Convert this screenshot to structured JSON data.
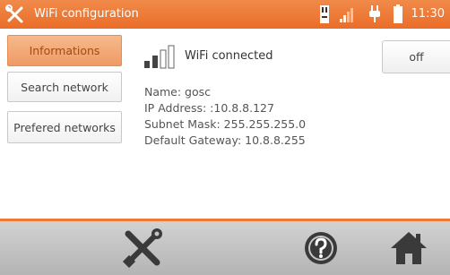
{
  "titlebar": {
    "title": "WiFi configuration",
    "time": "11:30",
    "icons": [
      "wrench-screwdriver-icon",
      "sd-card-icon",
      "signal-strength-icon",
      "plug-icon",
      "battery-icon"
    ]
  },
  "sidebar": {
    "items": [
      {
        "label": "Informations",
        "active": true
      },
      {
        "label": "Search network",
        "active": false
      },
      {
        "label": "Prefered networks",
        "active": false
      }
    ]
  },
  "wifi": {
    "status": "WiFi connected",
    "toggle_label": "off",
    "signal_bars_filled": 2,
    "signal_bars_total": 4
  },
  "info": {
    "name": "Name: gosc",
    "ip": "IP Address: :10.8.8.127",
    "mask": "Subnet Mask: 255.255.255.0",
    "gateway": "Default Gateway: 10.8.8.255"
  },
  "bottombar": {
    "icons": [
      "settings-tools-icon",
      "help-icon",
      "home-icon"
    ]
  },
  "colors": {
    "accent": "#ef7a36",
    "active_button": "#f3a876",
    "bottom_bar": "#c4c4c4"
  }
}
